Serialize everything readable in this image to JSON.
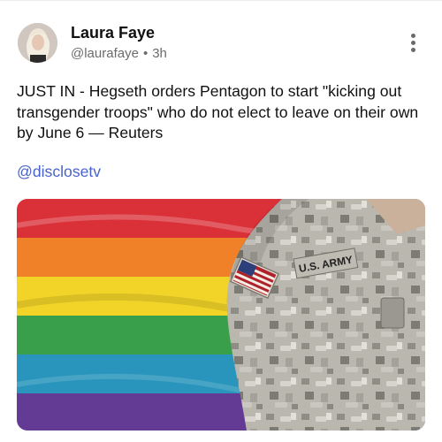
{
  "author": {
    "name": "Laura Faye",
    "handle": "@laurafaye",
    "separator": "•",
    "time": "3h"
  },
  "menu": {
    "icon": "more-vertical-icon"
  },
  "post": {
    "text": "JUST IN - Hegseth orders Pentagon to start \"kicking out transgender troops\" who do not elect to leave on their own by June 6 — Reuters",
    "mention": "@disclosetv"
  },
  "media": {
    "patch_text": "U.S. ARMY",
    "flag_colors": [
      "#d8242c",
      "#f07a1c",
      "#f2d21c",
      "#2e9a40",
      "#1c8fb8",
      "#5a2f8e"
    ]
  },
  "colors": {
    "link": "#4a63c8",
    "secondary_text": "#6b6b6b"
  }
}
